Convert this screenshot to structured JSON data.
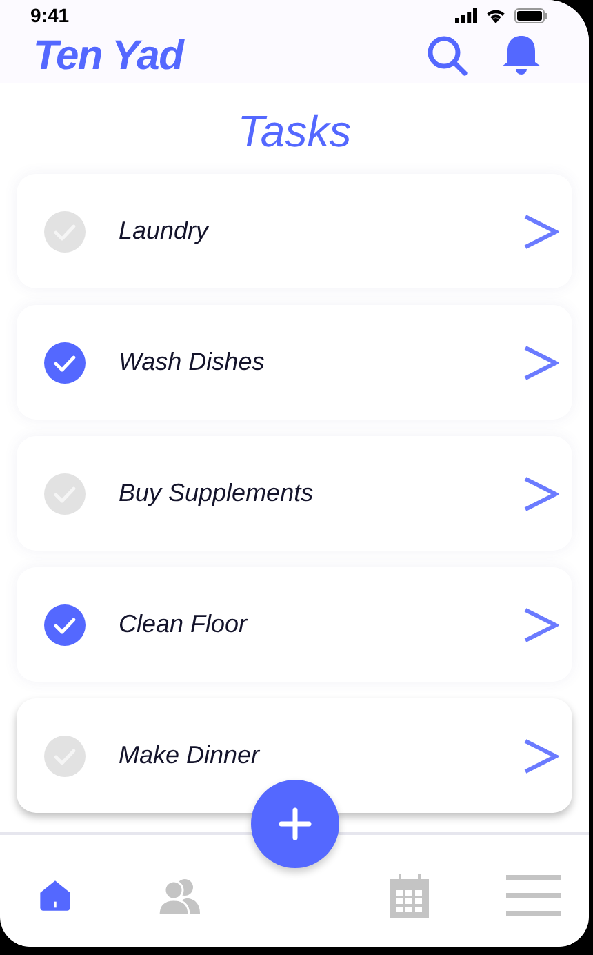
{
  "status_bar": {
    "time": "9:41"
  },
  "header": {
    "app_name": "Ten Yad"
  },
  "page_title": "Tasks",
  "tasks": [
    {
      "label": "Laundry",
      "checked": false
    },
    {
      "label": "Wash Dishes",
      "checked": true
    },
    {
      "label": "Buy Supplements",
      "checked": false
    },
    {
      "label": "Clean Floor",
      "checked": true
    },
    {
      "label": "Make Dinner",
      "checked": false
    }
  ],
  "bottom_nav": [
    {
      "kind": "home",
      "selected": true
    },
    {
      "kind": "people",
      "selected": false
    },
    {
      "kind": "calendar",
      "selected": false
    },
    {
      "kind": "menu",
      "selected": false
    }
  ]
}
